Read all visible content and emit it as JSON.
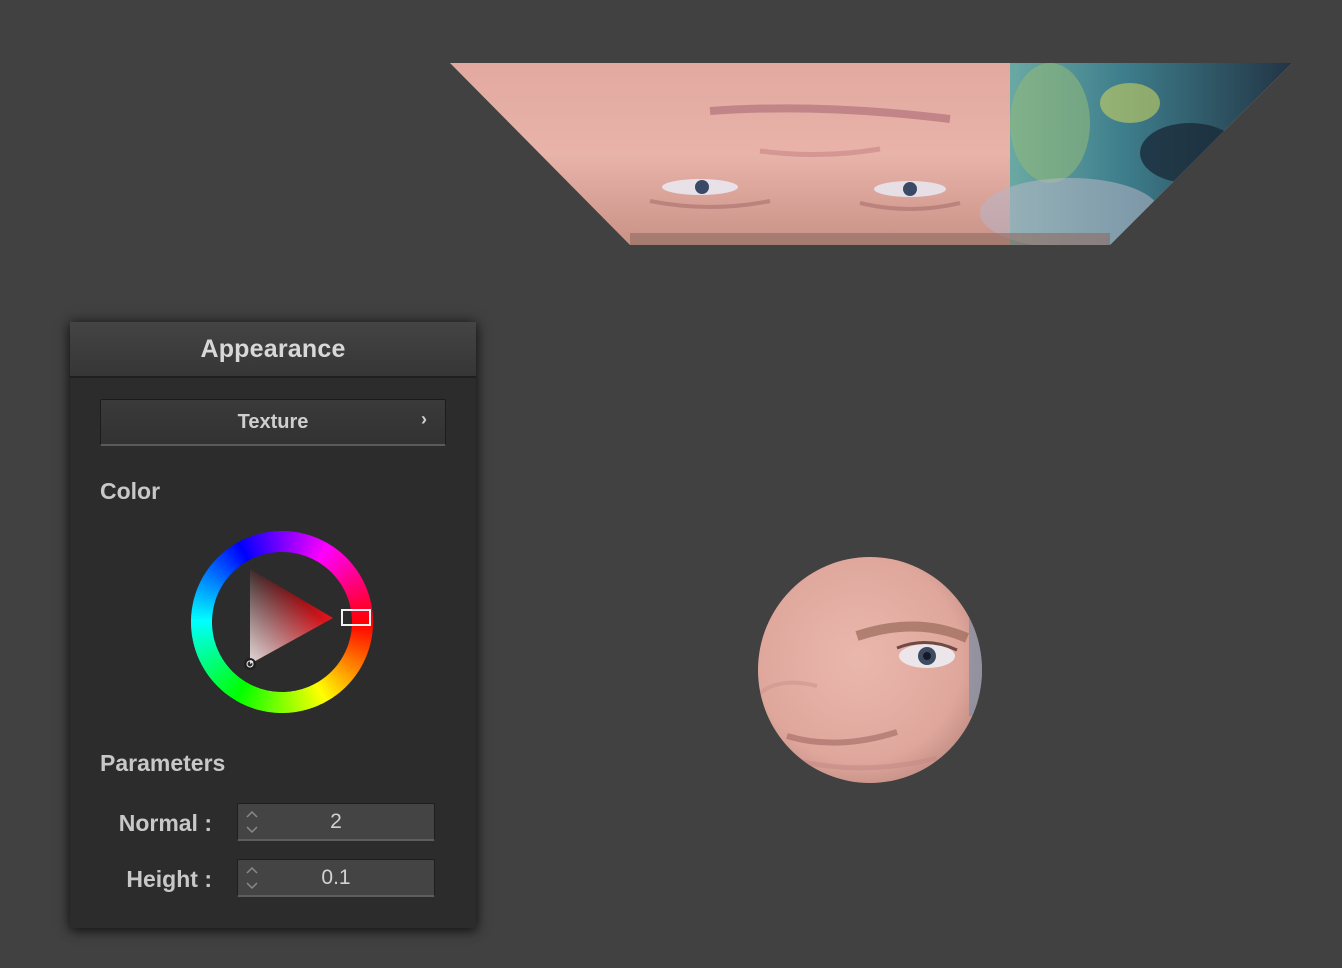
{
  "panel": {
    "title": "Appearance",
    "texture_button_label": "Texture",
    "texture_chevron": "›",
    "color_heading": "Color",
    "parameters_heading": "Parameters",
    "selected_color": "#e0141c",
    "params": [
      {
        "label": "Normal :",
        "value": "2"
      },
      {
        "label": "Height :",
        "value": "0.1"
      }
    ]
  },
  "icons": {
    "texture_button": "chevron-right-icon",
    "spinbox": "up-down-arrows-icon"
  },
  "colors": {
    "background": "#414141",
    "panel": "#2c2c2c",
    "text": "#c8c8c8"
  }
}
